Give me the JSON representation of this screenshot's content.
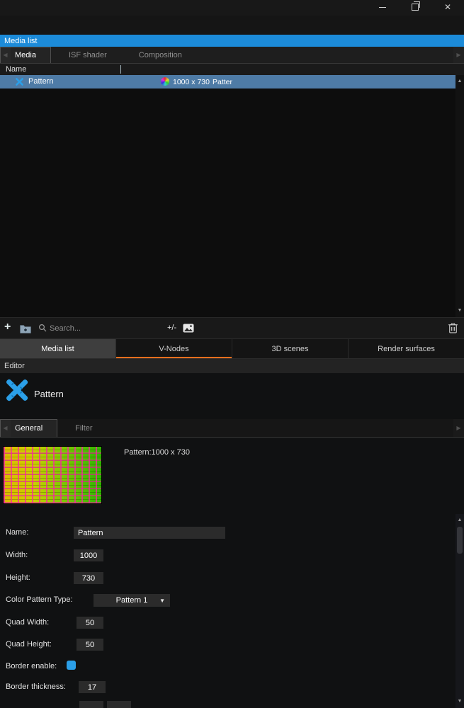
{
  "colors": {
    "accent_blue": "#1c8bd9",
    "selected_row": "#4e7ba6",
    "tab_accent_orange": "#ff6f1e",
    "icon_blue": "#2b9fe8",
    "input_bg": "#2b2b2b"
  },
  "titlebar": {
    "close": "✕"
  },
  "media_panel": {
    "title": "Media list",
    "scroll_left": "◀",
    "scroll_right": "▶",
    "tabs": [
      {
        "label": "Media"
      },
      {
        "label": "ISF shader"
      },
      {
        "label": "Composition"
      }
    ],
    "column_header": "Name",
    "row": {
      "name": "Pattern",
      "size": "1000 x 730",
      "type": "Patter"
    },
    "scroll_up": "▲",
    "scroll_down": "▼",
    "toolbar": {
      "add": "+",
      "plus_minus": "+/-",
      "search_placeholder": "Search..."
    },
    "bottom_tabs": [
      {
        "label": "Media list"
      },
      {
        "label": "V-Nodes"
      },
      {
        "label": "3D scenes"
      },
      {
        "label": "Render surfaces"
      }
    ]
  },
  "editor": {
    "header": "Editor",
    "item_title": "Pattern",
    "scroll_left": "◀",
    "scroll_right": "▶",
    "tabs": [
      {
        "label": "General"
      },
      {
        "label": "Filter"
      }
    ],
    "preview_caption": "Pattern:1000 x 730",
    "fields": {
      "name": {
        "label": "Name:",
        "value": "Pattern"
      },
      "width": {
        "label": "Width:",
        "value": "1000"
      },
      "height": {
        "label": "Height:",
        "value": "730"
      },
      "color_pattern_type": {
        "label": "Color Pattern Type:",
        "value": "Pattern 1",
        "caret": "▼"
      },
      "quad_width": {
        "label": "Quad Width:",
        "value": "50"
      },
      "quad_height": {
        "label": "Quad Height:",
        "value": "50"
      },
      "border_enable": {
        "label": "Border enable:"
      },
      "border_thickness": {
        "label": "Border thickness:",
        "value": "17"
      }
    },
    "scroll_up": "▲",
    "scroll_down": "▼"
  }
}
